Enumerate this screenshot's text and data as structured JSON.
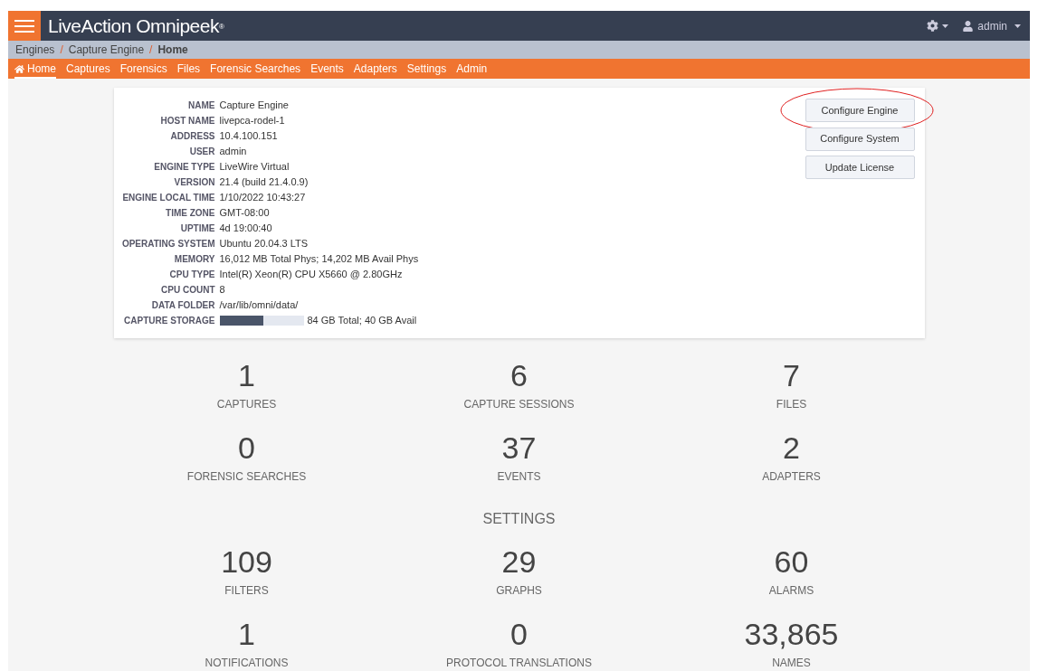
{
  "header": {
    "logo": "LiveAction Omnipeek",
    "logo_mark": "®",
    "user": "admin"
  },
  "breadcrumb": [
    "Engines",
    "Capture Engine",
    "Home"
  ],
  "breadcrumb_separator": "/",
  "nav": [
    {
      "label": "Home",
      "selected": true
    },
    {
      "label": "Captures",
      "selected": false
    },
    {
      "label": "Forensics",
      "selected": false
    },
    {
      "label": "Files",
      "selected": false
    },
    {
      "label": "Forensic Searches",
      "selected": false
    },
    {
      "label": "Events",
      "selected": false
    },
    {
      "label": "Adapters",
      "selected": false
    },
    {
      "label": "Settings",
      "selected": false
    },
    {
      "label": "Admin",
      "selected": false
    }
  ],
  "engine_info": [
    {
      "label": "NAME",
      "value": "Capture Engine"
    },
    {
      "label": "HOST NAME",
      "value": "livepca-rodel-1"
    },
    {
      "label": "ADDRESS",
      "value": "10.4.100.151"
    },
    {
      "label": "USER",
      "value": "admin"
    },
    {
      "label": "ENGINE TYPE",
      "value": "LiveWire Virtual"
    },
    {
      "label": "VERSION",
      "value": "21.4 (build 21.4.0.9)"
    },
    {
      "label": "ENGINE LOCAL TIME",
      "value": "1/10/2022 10:43:27"
    },
    {
      "label": "TIME ZONE",
      "value": "GMT-08:00"
    },
    {
      "label": "UPTIME",
      "value": "4d 19:00:40"
    },
    {
      "label": "OPERATING SYSTEM",
      "value": "Ubuntu 20.04.3 LTS"
    },
    {
      "label": "MEMORY",
      "value": "16,012 MB Total Phys; 14,202 MB Avail Phys"
    },
    {
      "label": "CPU TYPE",
      "value": "Intel(R) Xeon(R) CPU X5660 @ 2.80GHz"
    },
    {
      "label": "CPU COUNT",
      "value": "8"
    },
    {
      "label": "DATA FOLDER",
      "value": "/var/lib/omni/data/"
    },
    {
      "label": "CAPTURE STORAGE",
      "value": "84 GB Total; 40 GB Avail",
      "level": 0.52
    }
  ],
  "buttons": [
    {
      "label": "Configure Engine",
      "highlighted": true
    },
    {
      "label": "Configure System",
      "highlighted": false
    },
    {
      "label": "Update License",
      "highlighted": false
    }
  ],
  "stats": [
    {
      "value": "1",
      "label": "CAPTURES"
    },
    {
      "value": "6",
      "label": "CAPTURE SESSIONS"
    },
    {
      "value": "7",
      "label": "FILES"
    },
    {
      "value": "0",
      "label": "FORENSIC SEARCHES"
    },
    {
      "value": "37",
      "label": "EVENTS"
    },
    {
      "value": "2",
      "label": "ADAPTERS"
    }
  ],
  "settings_title": "SETTINGS",
  "settings": [
    {
      "value": "109",
      "label": "FILTERS"
    },
    {
      "value": "29",
      "label": "GRAPHS"
    },
    {
      "value": "60",
      "label": "ALARMS"
    },
    {
      "value": "1",
      "label": "NOTIFICATIONS"
    },
    {
      "value": "0",
      "label": "PROTOCOL TRANSLATIONS"
    },
    {
      "value": "33,865",
      "label": "NAMES"
    }
  ]
}
